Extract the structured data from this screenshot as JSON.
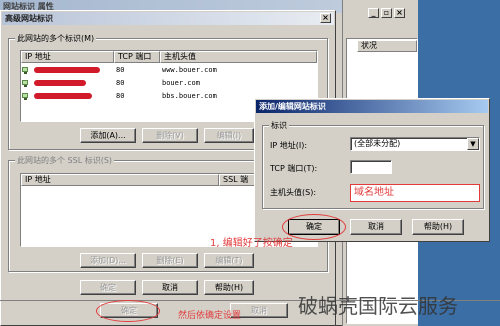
{
  "main_dialog": {
    "title": "高级网站标识",
    "close_label": "×",
    "identities_group_label": "此网站的多个标识(M)",
    "columns": [
      "IP 地址",
      "TCP 端口",
      "主机头值"
    ],
    "rows": [
      {
        "ip": "",
        "port": "80",
        "host": "www.bouer.com"
      },
      {
        "ip": "",
        "port": "80",
        "host": "bouer.com"
      },
      {
        "ip": "",
        "port": "80",
        "host": "bbs.bouer.com"
      }
    ],
    "add_button": "添加(A)...",
    "remove_button": "删除(V)",
    "edit_button": "编辑(I)",
    "ssl_group_label": "此网站的多个 SSL 标识(S)",
    "ssl_columns": [
      "IP 地址",
      "SSL 端"
    ],
    "ssl_add_button": "添加(D)...",
    "ssl_remove_button": "删除(E)",
    "ssl_edit_button": "编辑(T)",
    "ok_button": "确定",
    "cancel_button": "取消",
    "help_button": "帮助(H)"
  },
  "background_window": {
    "title_fragment": "网站标识  属性",
    "status_column": "状况",
    "footer_ok": "确定",
    "footer_extra": "取消"
  },
  "edit_dialog": {
    "title": "添加/编辑网站标识",
    "group_label": "标识",
    "ip_label": "IP 地址(I):",
    "ip_value": "(全部未分配)",
    "port_label": "TCP 端口(T):",
    "port_value": "",
    "host_label": "主机头值(S):",
    "host_value": "域名地址",
    "ok_button": "确定",
    "cancel_button": "取消",
    "help_button": "帮助(H)"
  },
  "annotations": {
    "step1": "1, 编辑好了按确定",
    "step2": "然后依确定设置"
  },
  "watermark": "破蜗壳国际云服务",
  "colors": {
    "accent_red": "#e23b3b",
    "window_face": "#d4d0c8",
    "desktop": "#3a6ea5"
  }
}
